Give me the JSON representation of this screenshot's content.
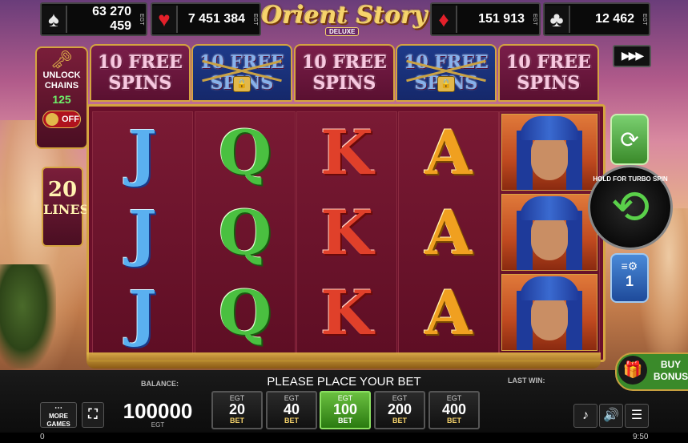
{
  "jackpots": [
    {
      "suit": "spade-icon",
      "symbol": "♠",
      "value": "63 270 459",
      "brand": "EGT"
    },
    {
      "suit": "heart-icon",
      "symbol": "♥",
      "value": "7 451 384",
      "brand": "EGT"
    },
    {
      "suit": "diamond-icon",
      "symbol": "♦",
      "value": "151 913",
      "brand": "EGT"
    },
    {
      "suit": "club-icon",
      "symbol": "♣",
      "value": "12 462",
      "brand": "EGT"
    }
  ],
  "logo": {
    "title": "Orient Story",
    "subtitle": "DELUXE"
  },
  "free_spins": [
    {
      "label": "10 FREE SPINS",
      "locked": false
    },
    {
      "label": "10 FREE SPINS",
      "locked": true
    },
    {
      "label": "10 FREE SPINS",
      "locked": false
    },
    {
      "label": "10 FREE SPINS",
      "locked": true
    },
    {
      "label": "10 FREE SPINS",
      "locked": false
    }
  ],
  "unlock": {
    "label": "UNLOCK CHAINS",
    "count": "125",
    "toggle": "OFF"
  },
  "lines": {
    "number": "20",
    "label": "LINES"
  },
  "reels": [
    [
      "J",
      "J",
      "J"
    ],
    [
      "Q",
      "Q",
      "Q"
    ],
    [
      "K",
      "K",
      "K"
    ],
    [
      "A",
      "A",
      "A"
    ],
    [
      "face",
      "face",
      "face"
    ]
  ],
  "spin": {
    "hint": "HOLD FOR TURBO SPIN"
  },
  "gamble": {
    "count": "1"
  },
  "bottom": {
    "balance_label": "BALANCE:",
    "balance_value": "100000",
    "balance_currency": "EGT",
    "message": "PLEASE PLACE YOUR BET",
    "last_win_label": "LAST WIN:",
    "more_games": "MORE GAMES",
    "buy_bonus": "BUY BONUS",
    "footer_left": "0",
    "footer_right": "9:50"
  },
  "bets": [
    {
      "top": "EGT",
      "value": "20",
      "bottom": "BET",
      "active": false
    },
    {
      "top": "EGT",
      "value": "40",
      "bottom": "BET",
      "active": false
    },
    {
      "top": "EGT",
      "value": "100",
      "bottom": "BET",
      "active": true
    },
    {
      "top": "EGT",
      "value": "200",
      "bottom": "BET",
      "active": false
    },
    {
      "top": "EGT",
      "value": "400",
      "bottom": "BET",
      "active": false
    }
  ],
  "colors": {
    "accent_gold": "#d4a440",
    "active_bet": "#6ac040",
    "maroon": "#6a0f2a"
  }
}
